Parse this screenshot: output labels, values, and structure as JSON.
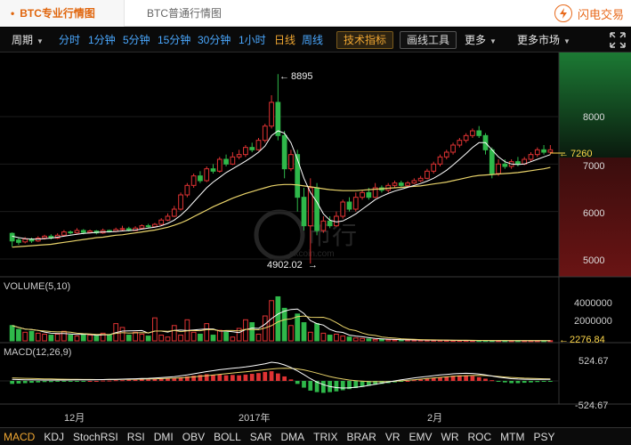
{
  "tabs": {
    "pro": "BTC专业行情图",
    "normal": "BTC普通行情图"
  },
  "brand": {
    "name": "闪电交易",
    "icon": "lightning-icon"
  },
  "toolbar": {
    "period_label": "周期",
    "periods": [
      "分时",
      "1分钟",
      "5分钟",
      "15分钟",
      "30分钟",
      "1小时",
      "日线",
      "周线"
    ],
    "active_period": "日线",
    "tech_indicator": "技术指标",
    "draw_tools": "画线工具",
    "more": "更多",
    "more_markets": "更多市场",
    "fullscreen_icon": "fullscreen-icon"
  },
  "price_panel": {
    "y_ticks": [
      "8000",
      "7000",
      "6000",
      "5000"
    ],
    "current_price": "7260",
    "high_label": "8895",
    "low_label": "4902.02",
    "watermark": "OKCoin 币行 okcoin.com"
  },
  "volume_panel": {
    "title": "VOLUME(5,10)",
    "y_ticks": [
      "4000000",
      "2000000"
    ],
    "current_value": "2276.84"
  },
  "macd_panel": {
    "title": "MACD(12,26,9)",
    "y_ticks": [
      "524.67",
      "-524.67"
    ]
  },
  "x_axis": [
    "12月",
    "2017年",
    "2月"
  ],
  "indicators": [
    "MACD",
    "KDJ",
    "StochRSI",
    "RSI",
    "DMI",
    "OBV",
    "BOLL",
    "SAR",
    "DMA",
    "TRIX",
    "BRAR",
    "VR",
    "EMV",
    "WR",
    "ROC",
    "MTM",
    "PSY"
  ],
  "active_indicator": "MACD",
  "colors": {
    "up": "#e03333",
    "down": "#2fb84a",
    "ma_short": "#ffffff",
    "ma_long": "#e9d36a",
    "accent": "#f0a732",
    "period": "#4aa8ff"
  },
  "chart_data": {
    "type": "candlestick",
    "price_range": [
      4700,
      9200
    ],
    "candles": [
      [
        5540,
        5380,
        5560,
        5260
      ],
      [
        5400,
        5350,
        5440,
        5300
      ],
      [
        5360,
        5420,
        5460,
        5330
      ],
      [
        5420,
        5380,
        5450,
        5340
      ],
      [
        5380,
        5440,
        5480,
        5360
      ],
      [
        5440,
        5480,
        5510,
        5410
      ],
      [
        5480,
        5440,
        5520,
        5410
      ],
      [
        5440,
        5500,
        5540,
        5420
      ],
      [
        5500,
        5570,
        5610,
        5480
      ],
      [
        5570,
        5550,
        5600,
        5520
      ],
      [
        5550,
        5600,
        5650,
        5530
      ],
      [
        5600,
        5560,
        5630,
        5520
      ],
      [
        5560,
        5590,
        5620,
        5540
      ],
      [
        5590,
        5550,
        5610,
        5520
      ],
      [
        5550,
        5600,
        5640,
        5530
      ],
      [
        5600,
        5580,
        5620,
        5560
      ],
      [
        5580,
        5620,
        5660,
        5560
      ],
      [
        5620,
        5640,
        5700,
        5600
      ],
      [
        5640,
        5600,
        5680,
        5580
      ],
      [
        5600,
        5650,
        5690,
        5590
      ],
      [
        5650,
        5700,
        5730,
        5630
      ],
      [
        5700,
        5680,
        5740,
        5660
      ],
      [
        5680,
        5730,
        5760,
        5660
      ],
      [
        5730,
        5820,
        5860,
        5700
      ],
      [
        5820,
        5900,
        5960,
        5800
      ],
      [
        5900,
        6050,
        6120,
        5880
      ],
      [
        6050,
        6350,
        6400,
        6020
      ],
      [
        6350,
        6550,
        6600,
        6300
      ],
      [
        6550,
        6750,
        6800,
        6500
      ],
      [
        6750,
        6650,
        6850,
        6600
      ],
      [
        6650,
        6900,
        6950,
        6620
      ],
      [
        6900,
        6850,
        7000,
        6800
      ],
      [
        6850,
        7100,
        7150,
        6820
      ],
      [
        7100,
        7000,
        7200,
        6950
      ],
      [
        7000,
        7150,
        7250,
        6980
      ],
      [
        7150,
        7200,
        7300,
        7100
      ],
      [
        7200,
        7350,
        7400,
        7150
      ],
      [
        7350,
        7300,
        7450,
        7250
      ],
      [
        7300,
        7500,
        7550,
        7280
      ],
      [
        7500,
        7800,
        7850,
        7450
      ],
      [
        7800,
        8300,
        8450,
        7750
      ],
      [
        8300,
        7600,
        8895,
        7500
      ],
      [
        7600,
        6900,
        7700,
        6700
      ],
      [
        6900,
        7200,
        7300,
        6850
      ],
      [
        7200,
        6300,
        7300,
        6000
      ],
      [
        6300,
        5700,
        6500,
        5600
      ],
      [
        5700,
        6500,
        6700,
        4902
      ],
      [
        6500,
        5600,
        6600,
        5500
      ],
      [
        5600,
        5800,
        5900,
        5550
      ],
      [
        5800,
        5700,
        5900,
        5650
      ],
      [
        5700,
        5900,
        6000,
        5680
      ],
      [
        5900,
        6200,
        6250,
        5850
      ],
      [
        6200,
        6050,
        6300,
        6000
      ],
      [
        6050,
        6300,
        6400,
        6000
      ],
      [
        6300,
        6400,
        6450,
        6250
      ],
      [
        6400,
        6300,
        6500,
        6250
      ],
      [
        6300,
        6500,
        6600,
        6280
      ],
      [
        6500,
        6450,
        6550,
        6400
      ],
      [
        6450,
        6550,
        6600,
        6400
      ],
      [
        6550,
        6600,
        6650,
        6500
      ],
      [
        6600,
        6550,
        6650,
        6520
      ],
      [
        6550,
        6600,
        6640,
        6520
      ],
      [
        6600,
        6650,
        6700,
        6580
      ],
      [
        6650,
        6700,
        6750,
        6620
      ],
      [
        6700,
        6850,
        6900,
        6680
      ],
      [
        6850,
        7000,
        7050,
        6800
      ],
      [
        7000,
        7150,
        7200,
        6950
      ],
      [
        7150,
        7250,
        7300,
        7100
      ],
      [
        7250,
        7400,
        7450,
        7200
      ],
      [
        7400,
        7500,
        7550,
        7350
      ],
      [
        7500,
        7600,
        7650,
        7450
      ],
      [
        7600,
        7700,
        7750,
        7550
      ],
      [
        7700,
        7600,
        7800,
        7550
      ],
      [
        7600,
        7300,
        7650,
        7200
      ],
      [
        7300,
        6800,
        7350,
        6700
      ],
      [
        6800,
        7000,
        7100,
        6750
      ],
      [
        7000,
        6950,
        7100,
        6900
      ],
      [
        6950,
        7050,
        7100,
        6900
      ],
      [
        7050,
        7000,
        7150,
        6950
      ],
      [
        7000,
        7100,
        7150,
        6980
      ],
      [
        7100,
        7200,
        7250,
        7050
      ],
      [
        7200,
        7300,
        7350,
        7150
      ],
      [
        7300,
        7250,
        7400,
        7200
      ],
      [
        7250,
        7300,
        7400,
        7200
      ]
    ],
    "ma_short": [
      5480,
      5450,
      5430,
      5420,
      5420,
      5430,
      5440,
      5460,
      5480,
      5500,
      5520,
      5540,
      5550,
      5560,
      5570,
      5570,
      5580,
      5590,
      5600,
      5610,
      5630,
      5650,
      5670,
      5700,
      5750,
      5820,
      5920,
      6050,
      6200,
      6350,
      6500,
      6620,
      6720,
      6820,
      6900,
      6980,
      7060,
      7150,
      7250,
      7380,
      7600,
      7700,
      7650,
      7450,
      7100,
      6700,
      6400,
      6200,
      5950,
      5820,
      5780,
      5800,
      5870,
      5950,
      6050,
      6150,
      6250,
      6320,
      6380,
      6430,
      6470,
      6510,
      6550,
      6590,
      6640,
      6700,
      6780,
      6870,
      6980,
      7100,
      7220,
      7350,
      7450,
      7450,
      7300,
      7150,
      7050,
      7000,
      6990,
      7000,
      7050,
      7100,
      7150,
      7200
    ],
    "ma_long": [
      5250,
      5260,
      5270,
      5280,
      5290,
      5300,
      5310,
      5330,
      5350,
      5370,
      5390,
      5410,
      5430,
      5450,
      5460,
      5480,
      5500,
      5510,
      5530,
      5550,
      5570,
      5590,
      5610,
      5640,
      5670,
      5710,
      5760,
      5820,
      5890,
      5960,
      6030,
      6100,
      6160,
      6220,
      6280,
      6330,
      6380,
      6420,
      6460,
      6500,
      6540,
      6560,
      6570,
      6570,
      6560,
      6540,
      6520,
      6500,
      6480,
      6460,
      6450,
      6440,
      6440,
      6440,
      6450,
      6460,
      6470,
      6480,
      6490,
      6500,
      6510,
      6520,
      6530,
      6540,
      6560,
      6580,
      6600,
      6620,
      6650,
      6680,
      6710,
      6740,
      6760,
      6770,
      6780,
      6790,
      6800,
      6810,
      6820,
      6840,
      6860,
      6880,
      6900,
      6930
    ],
    "volume_range": [
      0,
      5200000
    ],
    "volumes": [
      1600000,
      1200000,
      900000,
      1000000,
      800000,
      700000,
      600000,
      700000,
      1000000,
      600000,
      500000,
      700000,
      600000,
      500000,
      800000,
      600000,
      1800000,
      1400000,
      600000,
      900000,
      700000,
      500000,
      2400000,
      600000,
      400000,
      1600000,
      600000,
      2200000,
      900000,
      700000,
      1800000,
      600000,
      1100000,
      900000,
      400000,
      1300000,
      2200000,
      1900000,
      700000,
      2600000,
      4200000,
      4600000,
      3400000,
      1600000,
      2800000,
      1900000,
      900000,
      1800000,
      800000,
      600000,
      700000,
      500000,
      400000,
      300000,
      250000,
      200000,
      150000,
      150000,
      120000,
      100000,
      100000,
      90000,
      80000,
      80000,
      70000,
      60000,
      60000,
      50000,
      40000,
      40000,
      40000,
      30000,
      30000,
      30000,
      25000,
      25000,
      20000,
      20000,
      20000,
      20000,
      20000,
      20000,
      20000,
      20000
    ],
    "macd_range": [
      -524.67,
      524.67
    ],
    "macd_hist": [
      -80,
      -70,
      -60,
      -50,
      -40,
      -30,
      -30,
      -20,
      -20,
      -10,
      -10,
      -10,
      0,
      0,
      10,
      10,
      20,
      20,
      30,
      30,
      40,
      40,
      50,
      60,
      70,
      80,
      100,
      120,
      140,
      160,
      180,
      160,
      170,
      150,
      160,
      150,
      170,
      190,
      210,
      240,
      260,
      200,
      120,
      40,
      -80,
      -180,
      -260,
      -300,
      -320,
      -300,
      -280,
      -250,
      -220,
      -190,
      -160,
      -130,
      -100,
      -80,
      -60,
      -40,
      -20,
      0,
      20,
      40,
      60,
      80,
      100,
      120,
      140,
      150,
      150,
      130,
      100,
      60,
      20,
      -20,
      -40,
      -60,
      -60,
      -50,
      -40,
      -30,
      -20,
      -10
    ],
    "macd_dif": [
      40,
      35,
      30,
      28,
      26,
      25,
      24,
      24,
      25,
      26,
      28,
      30,
      32,
      34,
      36,
      40,
      44,
      48,
      52,
      58,
      64,
      70,
      78,
      88,
      100,
      115,
      135,
      160,
      190,
      220,
      250,
      275,
      300,
      320,
      340,
      355,
      375,
      400,
      430,
      460,
      500,
      480,
      430,
      360,
      270,
      170,
      60,
      -30,
      -100,
      -150,
      -180,
      -190,
      -185,
      -170,
      -150,
      -120,
      -90,
      -60,
      -30,
      0,
      30,
      55,
      80,
      100,
      120,
      140,
      160,
      175,
      190,
      200,
      205,
      200,
      185,
      160,
      130,
      100,
      80,
      60,
      50,
      45,
      40,
      40,
      40,
      40
    ],
    "macd_dea": [
      80,
      75,
      70,
      65,
      60,
      56,
      52,
      48,
      45,
      42,
      40,
      38,
      37,
      36,
      36,
      37,
      38,
      40,
      42,
      45,
      48,
      52,
      56,
      62,
      68,
      75,
      84,
      95,
      108,
      123,
      140,
      158,
      176,
      194,
      212,
      228,
      244,
      262,
      280,
      300,
      320,
      334,
      340,
      336,
      322,
      295,
      255,
      210,
      162,
      118,
      82,
      50,
      25,
      6,
      -8,
      -18,
      -22,
      -22,
      -18,
      -10,
      2,
      16,
      32,
      48,
      64,
      80,
      96,
      110,
      123,
      133,
      141,
      146,
      148,
      144,
      134,
      120,
      106,
      94,
      84,
      75,
      68,
      63,
      58,
      55
    ]
  }
}
